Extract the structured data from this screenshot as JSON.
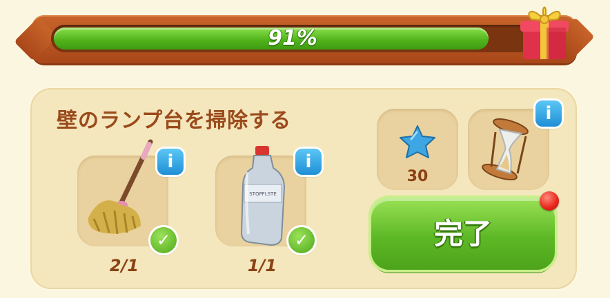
{
  "progress": {
    "value": 0.91,
    "label": "91%"
  },
  "task": {
    "title": "壁のランプ台を掃除する"
  },
  "items": [
    {
      "icon": "mop-icon",
      "count": "2/1",
      "completed": true
    },
    {
      "icon": "bottle-icon",
      "count": "1/1",
      "completed": true
    }
  ],
  "rewards": [
    {
      "icon": "blue-star-icon",
      "amount": "30"
    },
    {
      "icon": "hourglass-icon"
    }
  ],
  "complete_button": {
    "label": "完了"
  },
  "info_glyph": "i",
  "check_glyph": "✓",
  "colors": {
    "accent_green": "#5db826",
    "title_brown": "#9a4a1b",
    "frame_orange": "#c8642a",
    "notification_red": "#e8241b"
  }
}
